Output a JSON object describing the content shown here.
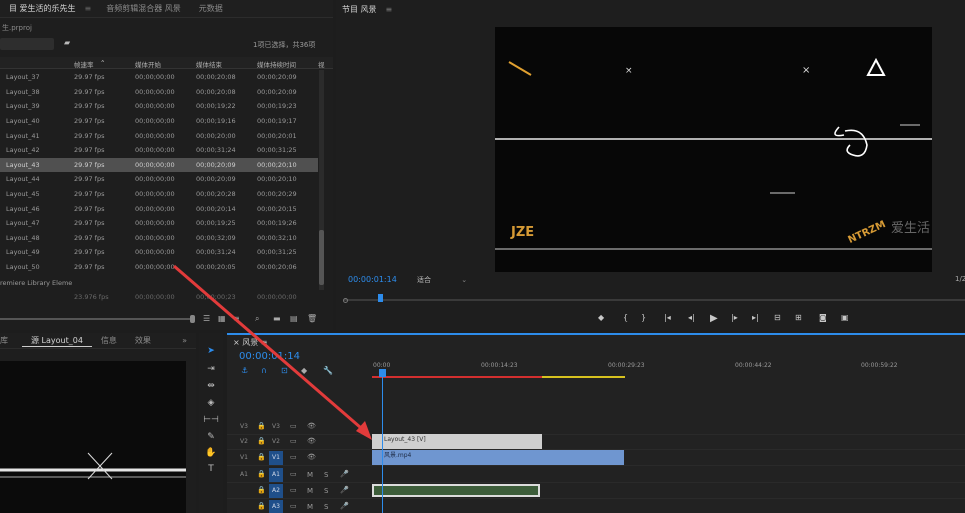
{
  "project": {
    "tabs": [
      "目 爱生活的乐先生",
      "音频剪辑混合器 风景",
      "元数据"
    ],
    "file": "生.prproj",
    "selection_info": "1项已选择，共36项",
    "columns": [
      "帧速率",
      "媒体开始",
      "媒体结束",
      "媒体持续时间",
      "视"
    ],
    "rows": [
      {
        "name": "Layout_37",
        "fps": "29.97 fps",
        "start": "00;00;00;00",
        "end": "00;00;20;08",
        "dur": "00;00;20;09"
      },
      {
        "name": "Layout_38",
        "fps": "29.97 fps",
        "start": "00;00;00;00",
        "end": "00;00;20;08",
        "dur": "00;00;20;09"
      },
      {
        "name": "Layout_39",
        "fps": "29.97 fps",
        "start": "00;00;00;00",
        "end": "00;00;19;22",
        "dur": "00;00;19;23"
      },
      {
        "name": "Layout_40",
        "fps": "29.97 fps",
        "start": "00;00;00;00",
        "end": "00;00;19;16",
        "dur": "00;00;19;17"
      },
      {
        "name": "Layout_41",
        "fps": "29.97 fps",
        "start": "00;00;00;00",
        "end": "00;00;20;00",
        "dur": "00;00;20;01"
      },
      {
        "name": "Layout_42",
        "fps": "29.97 fps",
        "start": "00;00;00;00",
        "end": "00;00;31;24",
        "dur": "00;00;31;25"
      },
      {
        "name": "Layout_43",
        "fps": "29.97 fps",
        "start": "00;00;00;00",
        "end": "00;00;20;09",
        "dur": "00;00;20;10"
      },
      {
        "name": "Layout_44",
        "fps": "29.97 fps",
        "start": "00;00;00;00",
        "end": "00;00;20;09",
        "dur": "00;00;20;10"
      },
      {
        "name": "Layout_45",
        "fps": "29.97 fps",
        "start": "00;00;00;00",
        "end": "00;00;20;28",
        "dur": "00;00;20;29"
      },
      {
        "name": "Layout_46",
        "fps": "29.97 fps",
        "start": "00;00;00;00",
        "end": "00;00;20;14",
        "dur": "00;00;20;15"
      },
      {
        "name": "Layout_47",
        "fps": "29.97 fps",
        "start": "00;00;00;00",
        "end": "00;00;19;25",
        "dur": "00;00;19;26"
      },
      {
        "name": "Layout_48",
        "fps": "29.97 fps",
        "start": "00;00;00;00",
        "end": "00;00;32;09",
        "dur": "00;00;32;10"
      },
      {
        "name": "Layout_49",
        "fps": "29.97 fps",
        "start": "00;00;00;00",
        "end": "00;00;31;24",
        "dur": "00;00;31;25"
      },
      {
        "name": "Layout_50",
        "fps": "29.97 fps",
        "start": "00;00;00;00",
        "end": "00;00;20;05",
        "dur": "00;00;20;06"
      }
    ],
    "footer_item": "remiere Library Eleme",
    "footer_row": {
      "fps": "23.976 fps",
      "start": "00;00;00;00",
      "end": "00;00;00;23",
      "dur": "00;00;00;00"
    }
  },
  "program": {
    "title": "节目 风景",
    "timecode": "00:00:01:14",
    "fit": "适合",
    "page": "1/2",
    "overlay_left": "JZE",
    "overlay_right": "NTRZM",
    "watermark": "爱生活"
  },
  "source": {
    "tabs": [
      "库",
      "源 Layout_04",
      "信息",
      "效果"
    ]
  },
  "timeline": {
    "title": "风景",
    "timecode": "00:00:01:14",
    "ruler": [
      "00:00",
      "00:00:14:23",
      "00:00:29:23",
      "00:00:44:22",
      "00:00:59:22"
    ],
    "tracks": [
      {
        "label": "V3",
        "target": "",
        "kind": "video"
      },
      {
        "label": "V2",
        "target": "",
        "kind": "video"
      },
      {
        "label": "V1",
        "target": "V1",
        "kind": "video"
      },
      {
        "label": "A1",
        "target": "A1",
        "kind": "audio"
      },
      {
        "label": "",
        "target": "A2",
        "kind": "audio"
      },
      {
        "label": "",
        "target": "A3",
        "kind": "audio"
      }
    ],
    "clips": {
      "v2": "Layout_43 [V]",
      "v1": "风景.mp4"
    },
    "mute_labels": [
      "M",
      "S"
    ]
  },
  "colors": {
    "accent": "#2d8ceb",
    "selected_row": "#505050",
    "v1_clip": "#6f96d0",
    "v2_clip": "#cfcfcf",
    "audio_clip": "#3d5d3a",
    "arrow": "#e23b3b"
  }
}
